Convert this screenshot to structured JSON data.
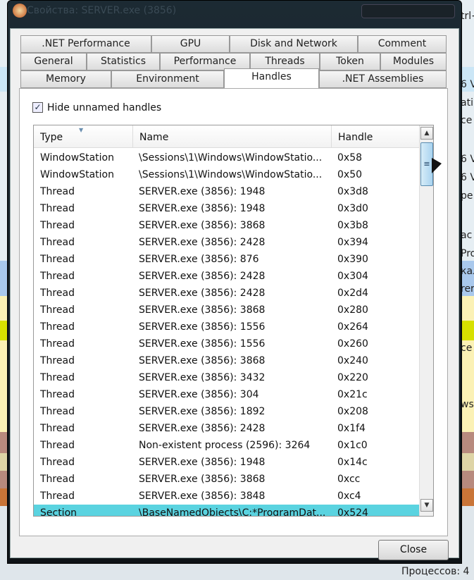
{
  "window": {
    "title": "Свойства: SERVER.exe (3856)"
  },
  "tabs": {
    "row1": [
      ".NET Performance",
      "GPU",
      "Disk and Network",
      "Comment"
    ],
    "row2": [
      "General",
      "Statistics",
      "Performance",
      "Threads",
      "Token",
      "Modules"
    ],
    "row3": [
      "Memory",
      "Environment",
      "Handles",
      ".NET Assemblies"
    ],
    "active": "Handles"
  },
  "options": {
    "hide_unnamed_label": "Hide unnamed handles",
    "hide_unnamed_checked": true
  },
  "table": {
    "columns": [
      "Type",
      "Name",
      "Handle"
    ],
    "sorted_column": "Type",
    "rows": [
      [
        "WindowStation",
        "\\Sessions\\1\\Windows\\WindowStatio...",
        "0x58"
      ],
      [
        "WindowStation",
        "\\Sessions\\1\\Windows\\WindowStatio...",
        "0x50"
      ],
      [
        "Thread",
        "SERVER.exe (3856): 1948",
        "0x3d8"
      ],
      [
        "Thread",
        "SERVER.exe (3856): 1948",
        "0x3d0"
      ],
      [
        "Thread",
        "SERVER.exe (3856): 3868",
        "0x3b8"
      ],
      [
        "Thread",
        "SERVER.exe (3856): 2428",
        "0x394"
      ],
      [
        "Thread",
        "SERVER.exe (3856): 876",
        "0x390"
      ],
      [
        "Thread",
        "SERVER.exe (3856): 2428",
        "0x304"
      ],
      [
        "Thread",
        "SERVER.exe (3856): 2428",
        "0x2d4"
      ],
      [
        "Thread",
        "SERVER.exe (3856): 3868",
        "0x280"
      ],
      [
        "Thread",
        "SERVER.exe (3856): 1556",
        "0x264"
      ],
      [
        "Thread",
        "SERVER.exe (3856): 1556",
        "0x260"
      ],
      [
        "Thread",
        "SERVER.exe (3856): 3868",
        "0x240"
      ],
      [
        "Thread",
        "SERVER.exe (3856): 3432",
        "0x220"
      ],
      [
        "Thread",
        "SERVER.exe (3856): 304",
        "0x21c"
      ],
      [
        "Thread",
        "SERVER.exe (3856): 1892",
        "0x208"
      ],
      [
        "Thread",
        "SERVER.exe (3856): 2428",
        "0x1f4"
      ],
      [
        "Thread",
        "Non-existent process (2596): 3264",
        "0x1c0"
      ],
      [
        "Thread",
        "SERVER.exe (3856): 1948",
        "0x14c"
      ],
      [
        "Thread",
        "SERVER.exe (3856): 3868",
        "0xcc"
      ],
      [
        "Thread",
        "SERVER.exe (3856): 3848",
        "0xc4"
      ],
      [
        "Section",
        "\\BaseNamedObjects\\C:*ProgramDat...",
        "0x524"
      ]
    ],
    "selected_row": 21
  },
  "buttons": {
    "close": "Close"
  },
  "background": {
    "texts": [
      "trl+",
      "6 V",
      "ati",
      "ce",
      "6 V",
      "6 V",
      "pe",
      "ac",
      "Pro",
      "кал",
      "rer",
      "ce",
      "ws"
    ],
    "status": "Процессов: 4"
  },
  "colors": {
    "selection": "#5ad3e0",
    "frame": "#121a20"
  }
}
